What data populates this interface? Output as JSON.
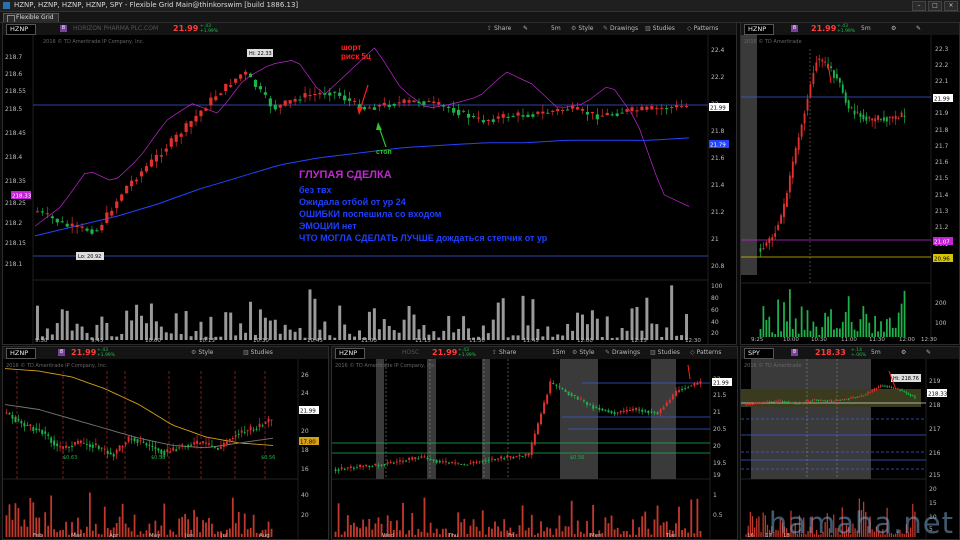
{
  "window": {
    "title": "HZNP, HZNP, HZNP, HZNP, SPY - Flexible Grid Main@thinkorswim [build 1886.13]",
    "tab": "Flexible Grid"
  },
  "colors": {
    "up": "#1db34a",
    "down": "#e23030",
    "price_red": "#ff3b3b",
    "purple": "#c026d3",
    "blue_note": "#1f3fff",
    "bg": "#000000"
  },
  "main_panel": {
    "symbol": "HZNP",
    "badge": "8",
    "price": "21.99",
    "change": "+.43",
    "change_pct": "+1.99%",
    "company": "HORIZON PHARMA PLC.COM",
    "buttons": {
      "share": "Share",
      "interval": "5m",
      "style": "Style",
      "drawings": "Drawings",
      "studies": "Studies",
      "patterns": "Patterns"
    },
    "copyright": "2016 © TD Ameritrade IP Company, Inc.",
    "hi_label": "Hi: 22.33",
    "lo_label": "Lo: 20.92",
    "right_axis": [
      "22.4",
      "22.2",
      "22",
      "21.8",
      "21.6",
      "21.4",
      "21.2",
      "21",
      "20.8"
    ],
    "left_axis": [
      "218.7",
      "218.6",
      "218.55",
      "218.5",
      "218.45",
      "218.4",
      "218.35",
      "218.25",
      "218.2",
      "218.15",
      "218.1"
    ],
    "tag_price": "21.99",
    "tag_ma": "21.79",
    "tag_spy": "218.33",
    "volume_axis": [
      "100",
      "80",
      "60",
      "40",
      "20"
    ],
    "volume_unit": "<thousands>",
    "time_axis": [
      "9:30",
      "9:45",
      "10:00",
      "10:15",
      "10:30",
      "10:45",
      "11:00",
      "11:15",
      "11:30",
      "11:45",
      "12:00",
      "12:15",
      "12:30"
    ],
    "notes": {
      "short_line1": "шорт",
      "short_line2": "риск 5ц",
      "stop": "стоп",
      "headline": "ГЛУПАЯ  СДЕЛКА",
      "line1": "без твх",
      "line2": "Ожидала отбой от ур 24",
      "line3": "ОШИБКИ поспешила со входом",
      "line4": "ЭМОЦИИ нет",
      "line5": "ЧТО МОГЛА СДЕЛАТЬ ЛУЧШЕ дождаться степчик от ур"
    }
  },
  "top_right_panel": {
    "symbol": "HZNP",
    "badge": "8",
    "price": "21.99",
    "change": "+.43",
    "change_pct": "+1.99%",
    "interval": "5m",
    "copyright": "2016 © TD Ameritrade",
    "right_axis": [
      "22.3",
      "22.2",
      "22.1",
      "22",
      "21.9",
      "21.8",
      "21.7",
      "21.6",
      "21.5",
      "21.4",
      "21.3",
      "21.2",
      "21.1",
      "21"
    ],
    "tag_price": "21.99",
    "tag_level_a": "21.07",
    "tag_level_b": "20.96",
    "volume_axis": [
      "200",
      "100"
    ],
    "volume_unit": "<thousands>",
    "time_axis": [
      "9:25",
      "10:00",
      "10:30",
      "11:00",
      "11:30",
      "12:00",
      "12:30"
    ]
  },
  "bottom_left_panel": {
    "symbol": "HZNP",
    "badge": "8",
    "price": "21.99",
    "change": "+.43",
    "change_pct": "+1.99%",
    "style": "Style",
    "studies": "Studies",
    "copyright": "2016 © TD Ameritrade IP Company, Inc.",
    "right_axis": [
      "26",
      "24",
      "22",
      "20",
      "18",
      "16"
    ],
    "tag_price": "21.99",
    "tag_level": "17.80",
    "volume_axis": [
      "40",
      "20"
    ],
    "volume_unit": "<millions>",
    "time_axis": [
      "Feb",
      "Mar",
      "Apr",
      "May",
      "Jun",
      "Jul",
      "Aug"
    ],
    "dividend_labels": [
      "$0.63",
      "$0.58",
      "$0.56"
    ]
  },
  "bottom_mid_panel": {
    "symbol": "HZNP",
    "symbol2": "HOSC",
    "price": "21.99",
    "change": "+.43",
    "change_pct": "+1.99%",
    "buttons": {
      "share": "Share",
      "interval": "15m",
      "style": "Style",
      "drawings": "Drawings",
      "studies": "Studies",
      "patterns": "Patterns"
    },
    "copyright": "2016 © TD Ameritrade IP Company, Inc.",
    "right_axis": [
      "22",
      "21.5",
      "21",
      "20.5",
      "20",
      "19.5",
      "19"
    ],
    "tag_price": "21.99",
    "event_label": "$0.56",
    "volume_axis": [
      "1",
      "0.5"
    ],
    "volume_unit": "<millions>",
    "time_axis": [
      "Wed",
      "Thu",
      "Fri",
      "Mon",
      "Tue"
    ]
  },
  "bottom_right_panel": {
    "symbol": "SPY",
    "badge": "8",
    "price": "218.33",
    "change": "+.14",
    "change_pct": "+.06%",
    "interval": "5m",
    "copyright": "2016 © TD Ameritrade",
    "hi_label": "Hi: 218.76",
    "right_axis": [
      "219",
      "218",
      "217",
      "216",
      "215"
    ],
    "tag_price": "218.33",
    "volume_axis": [
      "20",
      "15",
      "10",
      "5"
    ],
    "volume_unit": "<millions>",
    "time_axis": [
      "16",
      "17",
      "18"
    ]
  },
  "watermark": "hamaha.net"
}
